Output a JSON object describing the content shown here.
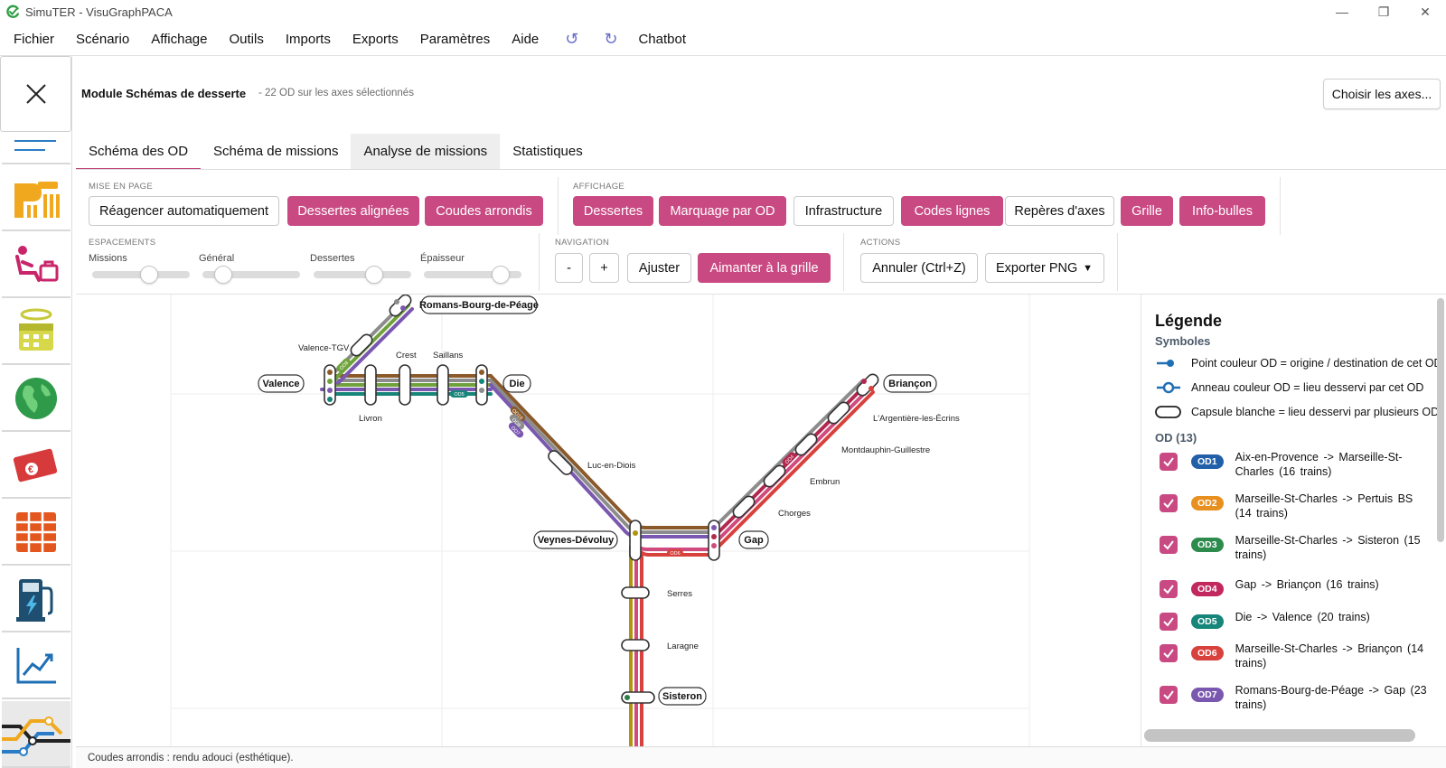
{
  "window": {
    "title": "SimuTER - VisuGraphPACA",
    "controls": [
      "—",
      "❐",
      "✕"
    ]
  },
  "menu": {
    "items": [
      "Fichier",
      "Scénario",
      "Affichage",
      "Outils",
      "Imports",
      "Exports",
      "Paramètres",
      "Aide"
    ],
    "undo": "↺",
    "redo": "↻",
    "chatbot": "Chatbot"
  },
  "header": {
    "module_title": "Module Schémas de desserte",
    "subtitle": "- 22 OD sur les axes sélectionnés",
    "choose_axes": "Choisir les axes..."
  },
  "tabs": [
    "Schéma des OD",
    "Schéma de missions",
    "Analyse de missions",
    "Statistiques"
  ],
  "toolbar": {
    "mise_en_page": {
      "label": "MISE EN PAGE",
      "buttons": [
        {
          "label": "Réagencer automatiquement",
          "on": false
        },
        {
          "label": "Dessertes alignées",
          "on": true
        },
        {
          "label": "Coudes arrondis",
          "on": true
        }
      ]
    },
    "affichage": {
      "label": "AFFICHAGE",
      "buttons": [
        {
          "label": "Dessertes",
          "on": true
        },
        {
          "label": "Marquage par OD",
          "on": true
        },
        {
          "label": "Infrastructure",
          "on": false
        },
        {
          "label": "Codes lignes",
          "on": true
        },
        {
          "label": "Repères d'axes",
          "on": false
        },
        {
          "label": "Grille",
          "on": true
        },
        {
          "label": "Info-bulles",
          "on": true
        }
      ]
    },
    "espacements": {
      "label": "ESPACEMENTS",
      "sliders": [
        {
          "label": "Missions",
          "value": 0.6
        },
        {
          "label": "Général",
          "value": 0.15
        },
        {
          "label": "Dessertes",
          "value": 0.65
        },
        {
          "label": "Épaisseur",
          "value": 0.85
        }
      ]
    },
    "navigation": {
      "label": "NAVIGATION",
      "zoom_out": "-",
      "zoom_in": "+",
      "fit": "Ajuster",
      "snap": "Aimanter à la grille"
    },
    "actions": {
      "label": "ACTIONS",
      "undo": "Annuler (Ctrl+Z)",
      "export": "Exporter PNG",
      "export_caret": "▼"
    }
  },
  "map": {
    "stations": {
      "romans": "Romans-Bourg-de-Péage",
      "valence_tgv": "Valence-TGV",
      "valence": "Valence",
      "crest": "Crest",
      "saillans": "Saillans",
      "die": "Die",
      "livron": "Livron",
      "luc": "Luc-en-Diois",
      "veynes": "Veynes-Dévoluy",
      "gap": "Gap",
      "serres": "Serres",
      "laragne": "Laragne",
      "sisteron": "Sisteron",
      "briancon": "Briançon",
      "argentiere": "L'Argentière-les-Écrins",
      "montdauphin": "Montdauphin-Guillestre",
      "embrun": "Embrun",
      "chorges": "Chorges"
    },
    "line_codes": {
      "od5": "OD5",
      "od6": "OD6",
      "od7": "OD7",
      "od8": "OD8",
      "od9": "OD9",
      "od10": "OD10",
      "od4": "OD4"
    },
    "colors": {
      "brown": "#8a5a2b",
      "purple": "#7b58b0",
      "gray": "#8c8c8c",
      "teal": "#16857a",
      "green": "#6fa23a",
      "pink": "#d04a7e",
      "red": "#d8413c",
      "crimson": "#b2284f",
      "olive": "#b0930f",
      "darkgreen": "#2e7d47"
    }
  },
  "legend": {
    "title": "Légende",
    "symbols_title": "Symboles",
    "symbols": [
      "Point couleur OD = origine / destination de cet OD",
      "Anneau couleur OD = lieu desservi par cet OD",
      "Capsule blanche = lieu desservi par plusieurs OD"
    ],
    "od_title": "OD (13)",
    "ods": [
      {
        "code": "OD1",
        "color": "#2160a8",
        "text": "Aix-en-Provence -> Marseille-St-Charles (16 trains)"
      },
      {
        "code": "OD2",
        "color": "#e8901f",
        "text": "Marseille-St-Charles -> Pertuis BS (14 trains)"
      },
      {
        "code": "OD3",
        "color": "#2e8b4e",
        "text": "Marseille-St-Charles -> Sisteron (15 trains)"
      },
      {
        "code": "OD4",
        "color": "#c2285d",
        "text": "Gap -> Briançon (16 trains)"
      },
      {
        "code": "OD5",
        "color": "#16857a",
        "text": "Die -> Valence (20 trains)"
      },
      {
        "code": "OD6",
        "color": "#d8413c",
        "text": "Marseille-St-Charles -> Briançon (14 trains)"
      },
      {
        "code": "OD7",
        "color": "#7b58b0",
        "text": "Romans-Bourg-de-Péage -> Gap (23 trains)"
      }
    ]
  },
  "status": "Coudes arrondis : rendu adouci (esthétique)."
}
